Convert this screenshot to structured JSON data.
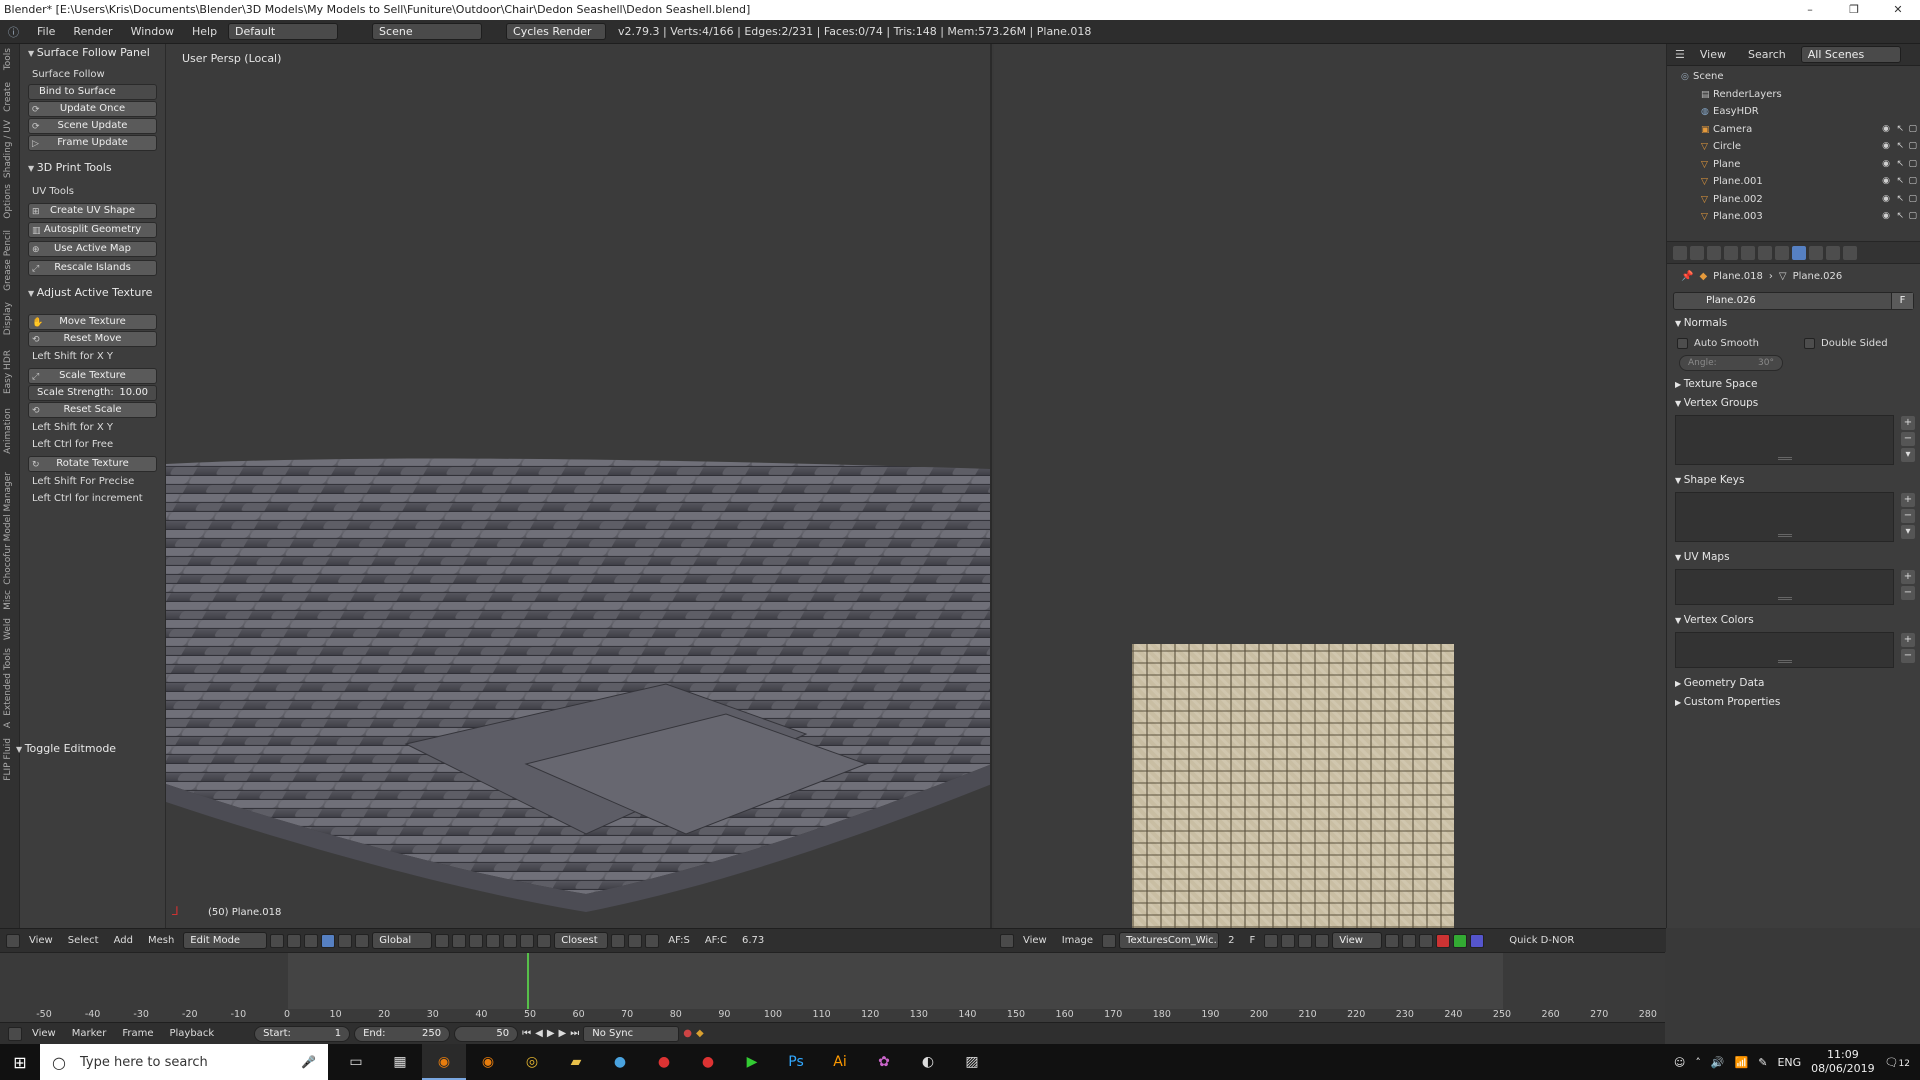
{
  "title": "Blender* [E:\\Users\\Kris\\Documents\\Blender\\3D Models\\My Models to Sell\\Funiture\\Outdoor\\Chair\\Dedon Seashell\\Dedon Seashell.blend]",
  "window_controls": [
    "–",
    "❐",
    "✕"
  ],
  "infobar": {
    "menus": [
      "File",
      "Render",
      "Window",
      "Help"
    ],
    "layout": "Default",
    "scene": "Scene",
    "engine": "Cycles Render",
    "stats": "v2.79.3 | Verts:4/166 | Edges:2/231 | Faces:0/74 | Tris:148 | Mem:573.26M | Plane.018"
  },
  "vertical_tabs": [
    "Tools",
    "Create",
    "Shading / UV",
    "Options",
    "Grease Pencil",
    "Display",
    "Easy HDR",
    "Animation",
    "Chocofur Model Manager",
    "Misc",
    "Weld",
    "Extended Tools",
    "A",
    "FLIP Fluid"
  ],
  "toolshelf": {
    "p1": {
      "title": "Surface Follow Panel",
      "sub": "Surface Follow",
      "bind": "Bind to Surface",
      "b1": "Update Once",
      "b2": "Scene Update",
      "b3": "Frame Update"
    },
    "p2": {
      "title": "3D Print Tools",
      "sub": "UV Tools",
      "b1": "Create UV Shape",
      "b2": "Autosplit Geometry",
      "b3": "Use Active Map",
      "b4": "Rescale Islands"
    },
    "p3": {
      "title": "Adjust Active Texture",
      "move": "Move Texture",
      "reset_move": "Reset Move",
      "hint1": "Left Shift for X Y",
      "scale": "Scale Texture",
      "strength_label": "Scale Strength:",
      "strength_value": "10.00",
      "reset_scale": "Reset Scale",
      "hint2": "Left Shift for X Y",
      "hint3": "Left Ctrl for Free",
      "rotate": "Rotate Texture",
      "hint4": "Left Shift For Precise",
      "hint5": "Left Ctrl for increment"
    },
    "toggle": "Toggle Editmode"
  },
  "viewport": {
    "label": "User Persp (Local)",
    "object": "(50) Plane.018"
  },
  "outliner": {
    "menus": [
      "View",
      "Search"
    ],
    "filter": "All Scenes",
    "rows": [
      "Scene",
      "RenderLayers",
      "EasyHDR",
      "Camera",
      "Circle",
      "Plane",
      "Plane.001",
      "Plane.002",
      "Plane.003"
    ]
  },
  "properties": {
    "crumb_obj": "Plane.018",
    "crumb_mesh": "Plane.026",
    "mesh_name": "Plane.026",
    "fake_user": "F",
    "normals": "Normals",
    "auto_smooth": "Auto Smooth",
    "double_sided": "Double Sided",
    "angle_label": "Angle:",
    "angle_value": "30°",
    "texture_space": "Texture Space",
    "vertex_groups": "Vertex Groups",
    "shape_keys": "Shape Keys",
    "uv_maps": "UV Maps",
    "vertex_colors": "Vertex Colors",
    "geometry_data": "Geometry Data",
    "custom_properties": "Custom Properties"
  },
  "header3d": {
    "menus": [
      "View",
      "Select",
      "Add",
      "Mesh"
    ],
    "mode": "Edit Mode",
    "orientation": "Global",
    "snap": "Closest",
    "af_s": "AF:S",
    "af_c": "AF:C",
    "value": "6.73"
  },
  "header_img": {
    "menus": [
      "View",
      "Image"
    ],
    "image": "TexturesCom_Wic...",
    "users": "2",
    "fake": "F",
    "view": "View",
    "quick": "Quick D-NOR"
  },
  "timeline": {
    "ticks": [
      "-50",
      "-40",
      "-30",
      "-20",
      "-10",
      "0",
      "10",
      "20",
      "30",
      "40",
      "50",
      "60",
      "70",
      "80",
      "90",
      "100",
      "110",
      "120",
      "130",
      "140",
      "150",
      "160",
      "170",
      "180",
      "190",
      "200",
      "210",
      "220",
      "230",
      "240",
      "250",
      "260",
      "270",
      "280"
    ],
    "menus": [
      "View",
      "Marker",
      "Frame",
      "Playback"
    ],
    "start": "Start:",
    "start_value": "1",
    "end": "End:",
    "end_value": "250",
    "current": "50",
    "sync": "No Sync"
  },
  "taskbar": {
    "search": "Type here to search",
    "lang": "ENG",
    "time": "11:09",
    "date": "08/06/2019",
    "notif": "12"
  }
}
